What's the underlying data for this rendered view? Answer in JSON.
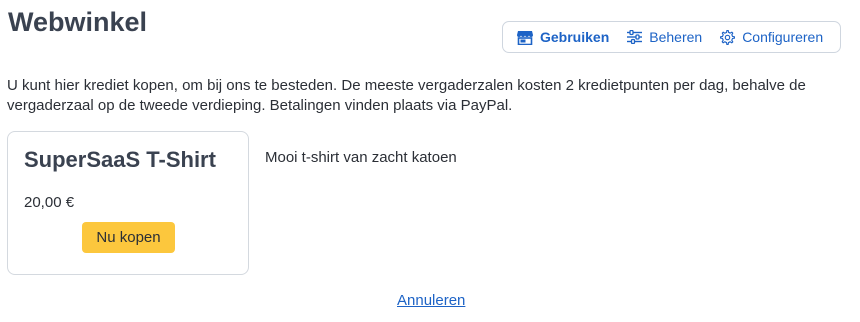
{
  "page": {
    "title": "Webwinkel"
  },
  "mode_bar": {
    "items": [
      {
        "label": "Gebruiken",
        "icon": "storefront-icon",
        "active": true
      },
      {
        "label": "Beheren",
        "icon": "sliders-icon",
        "active": false
      },
      {
        "label": "Configureren",
        "icon": "gear-icon",
        "active": false
      }
    ]
  },
  "intro": {
    "text": "U kunt hier krediet kopen, om bij ons te besteden. De meeste vergaderzalen kosten 2 kredietpunten per dag, behalve de vergaderzaal op de tweede verdieping. Betalingen vinden plaats via PayPal."
  },
  "product": {
    "name": "SuperSaaS T-Shirt",
    "price": "20,00 €",
    "buy_label": "Nu kopen",
    "description": "Mooi t-shirt van zacht katoen"
  },
  "footer": {
    "cancel_label": "Annuleren"
  },
  "colors": {
    "accent": "#1d63c6",
    "buy_button": "#fcc73d",
    "heading": "#3a4250"
  }
}
